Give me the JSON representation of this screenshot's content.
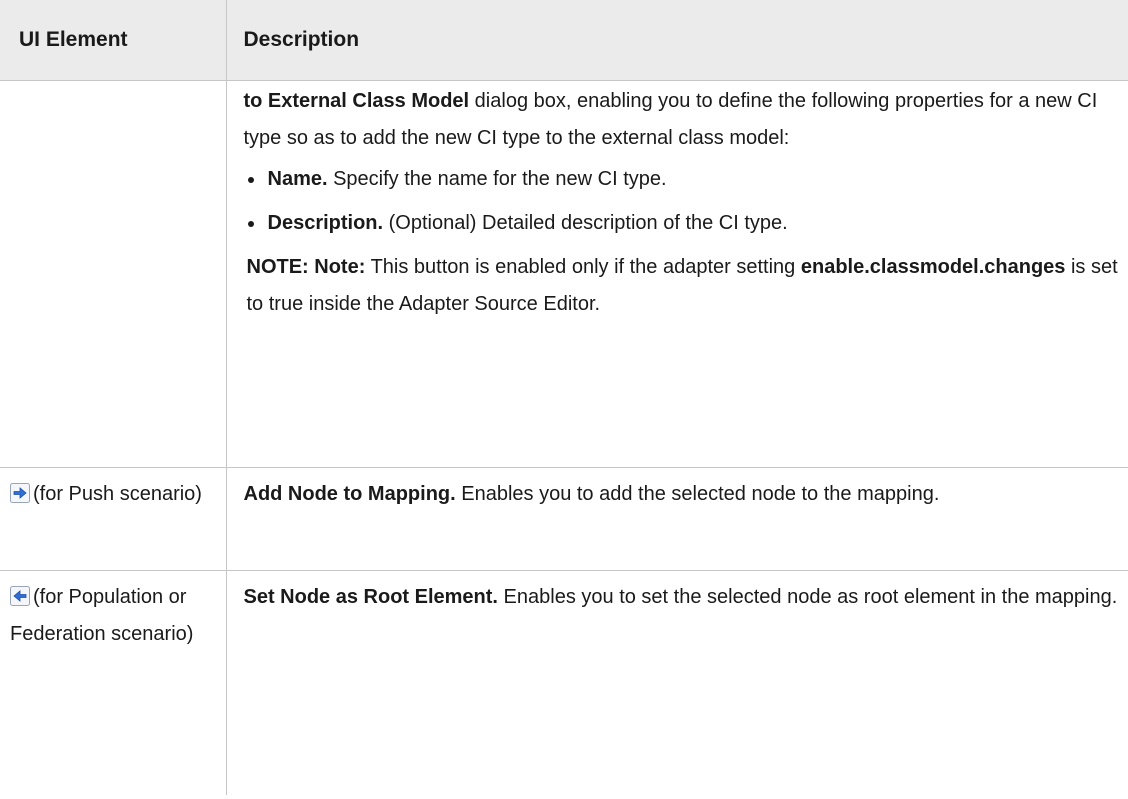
{
  "table": {
    "header": {
      "col1": "UI Element",
      "col2": "Description"
    },
    "row1": {
      "intro_bold": "to External Class Model",
      "intro_rest": " dialog box, enabling you to define the following properties for a new CI type so as to add the new CI type to the external class model:",
      "props": [
        {
          "label": "Name.",
          "text": " Specify the name for the new CI type."
        },
        {
          "label": "Description.",
          "text": " (Optional) Detailed description of the CI type."
        }
      ],
      "note_label": "NOTE: Note:",
      "note_text1": " This button is enabled only if the adapter setting ",
      "note_setting": "enable.classmodel.changes",
      "note_text2": " is set to true inside the Adapter Source Editor."
    },
    "row2": {
      "icon": "arrow-right-icon",
      "element_text": "(for Push scenario)",
      "desc_bold": "Add Node to Mapping.",
      "desc_text": " Enables you to add the selected node to the mapping."
    },
    "row3": {
      "icon": "arrow-left-icon",
      "element_text": "(for Population or Federation scenario)",
      "desc_bold": "Set Node as Root Element.",
      "desc_text": " Enables you to set the selected node as root element in the mapping."
    }
  },
  "colors": {
    "header_bg": "#ebebeb",
    "border": "#c6c6c6",
    "icon_blue": "#2f6fd6"
  }
}
